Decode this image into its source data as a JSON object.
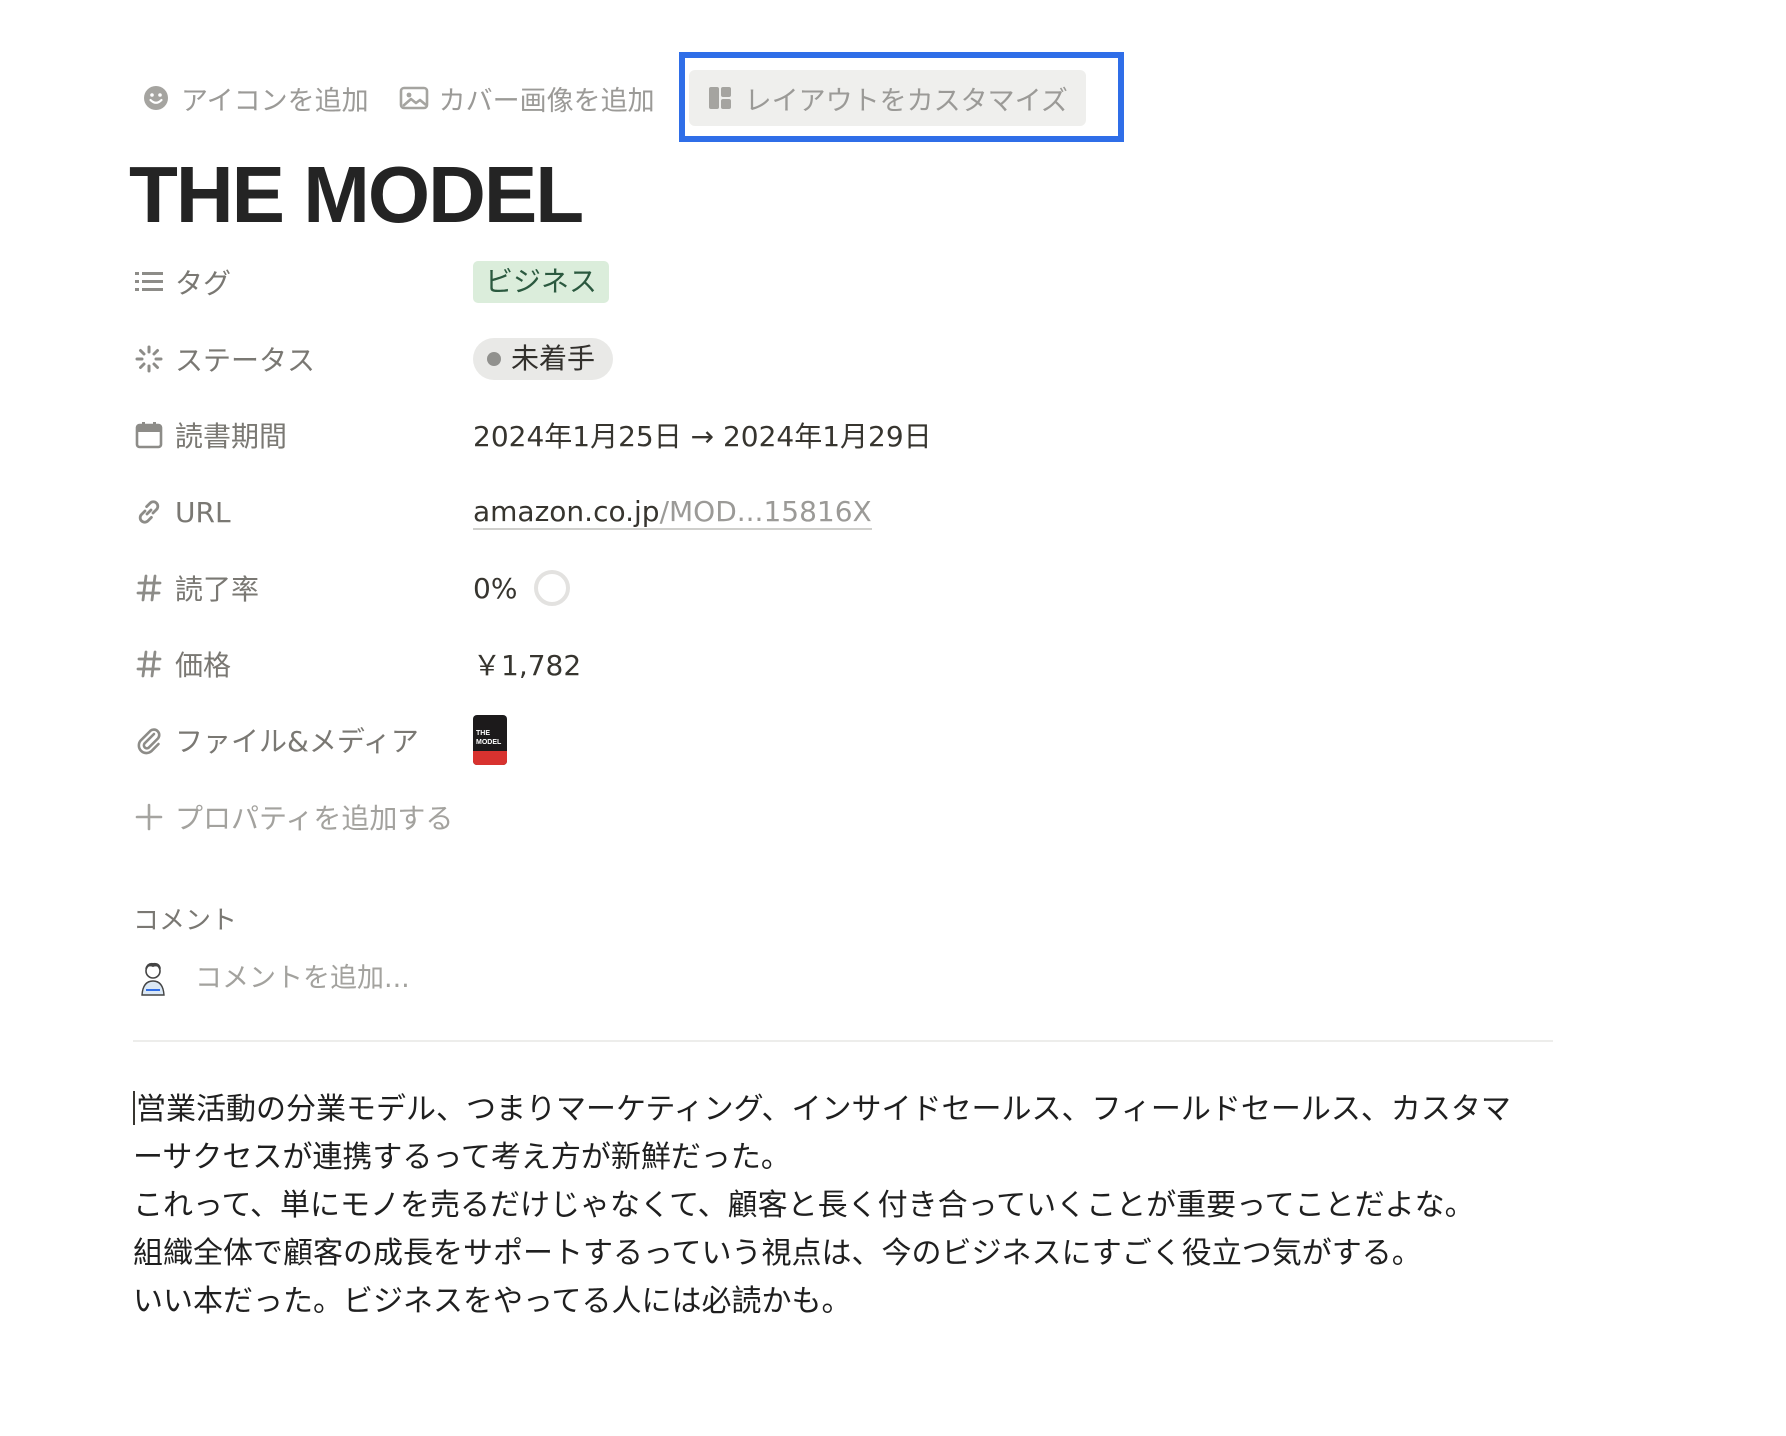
{
  "actions": {
    "add_icon": "アイコンを追加",
    "add_cover": "カバー画像を追加",
    "customize_layout": "レイアウトをカスタマイズ"
  },
  "page": {
    "title": "THE MODEL"
  },
  "properties": {
    "tag": {
      "name": "タグ",
      "value": "ビジネス"
    },
    "status": {
      "name": "ステータス",
      "value": "未着手"
    },
    "reading_period": {
      "name": "読書期間",
      "value": "2024年1月25日 → 2024年1月29日"
    },
    "url": {
      "name": "URL",
      "domain": "amazon.co.jp",
      "path": "/MOD...15816X"
    },
    "read_rate": {
      "name": "読了率",
      "value": "0%",
      "progress": 0
    },
    "price": {
      "name": "価格",
      "value": "￥1,782"
    },
    "files": {
      "name": "ファイル&メディア"
    },
    "add_property": "プロパティを追加する"
  },
  "comments": {
    "heading": "コメント",
    "placeholder": "コメントを追加..."
  },
  "body": {
    "paragraphs": [
      "営業活動の分業モデル、つまりマーケティング、インサイドセールス、フィールドセールス、カスタマーサクセスが連携するって考え方が新鮮だった。",
      "これって、単にモノを売るだけじゃなくて、顧客と長く付き合っていくことが重要ってことだよな。",
      "組織全体で顧客の成長をサポートするっていう視点は、今のビジネスにすごく役立つ気がする。",
      "いい本だった。ビジネスをやってる人には必読かも。"
    ]
  },
  "colors": {
    "highlight_frame": "#2f6ee8",
    "tag_bg": "#dbeddb",
    "tag_text": "#2b593f",
    "status_bg": "#e9e9e7"
  },
  "icons": {
    "add_icon": "smiley-icon",
    "add_cover": "image-icon",
    "customize_layout": "layout-icon",
    "tag": "list-icon",
    "status": "status-spinner-icon",
    "reading_period": "calendar-icon",
    "url": "link-icon",
    "read_rate": "number-icon",
    "price": "number-icon",
    "files": "paperclip-icon",
    "add_property": "plus-icon"
  }
}
